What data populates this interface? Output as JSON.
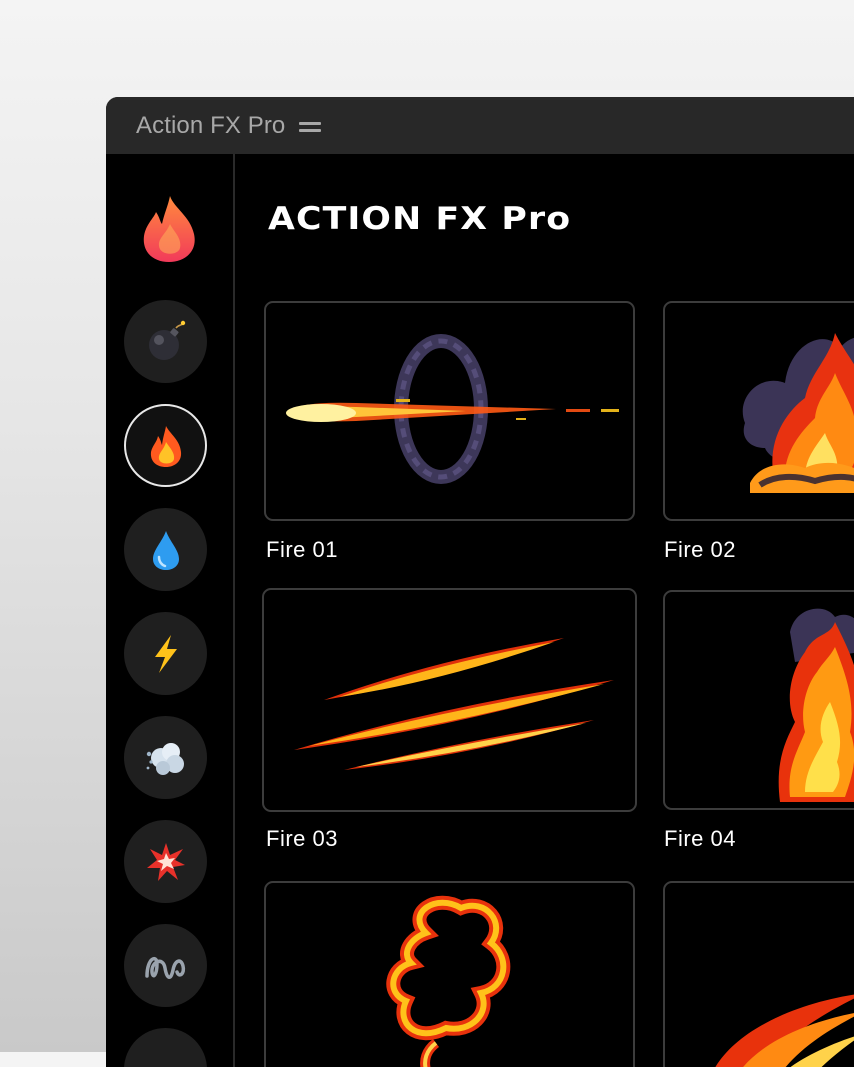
{
  "window": {
    "title": "Action FX Pro",
    "menu_icon": "hamburger-icon"
  },
  "sidebar": {
    "logo_icon": "flame-icon",
    "items": [
      {
        "icon": "bomb-icon",
        "active": false
      },
      {
        "icon": "fire-icon",
        "active": true
      },
      {
        "icon": "water-drop-icon",
        "active": false
      },
      {
        "icon": "lightning-icon",
        "active": false
      },
      {
        "icon": "smoke-cloud-icon",
        "active": false
      },
      {
        "icon": "explosion-icon",
        "active": false
      },
      {
        "icon": "squiggle-icon",
        "active": false
      }
    ]
  },
  "main": {
    "heading": "ACTION FX Pro",
    "effects": [
      {
        "label": "Fire 01"
      },
      {
        "label": "Fire 02"
      },
      {
        "label": "Fire 03"
      },
      {
        "label": "Fire 04"
      },
      {
        "label": ""
      },
      {
        "label": ""
      }
    ]
  }
}
